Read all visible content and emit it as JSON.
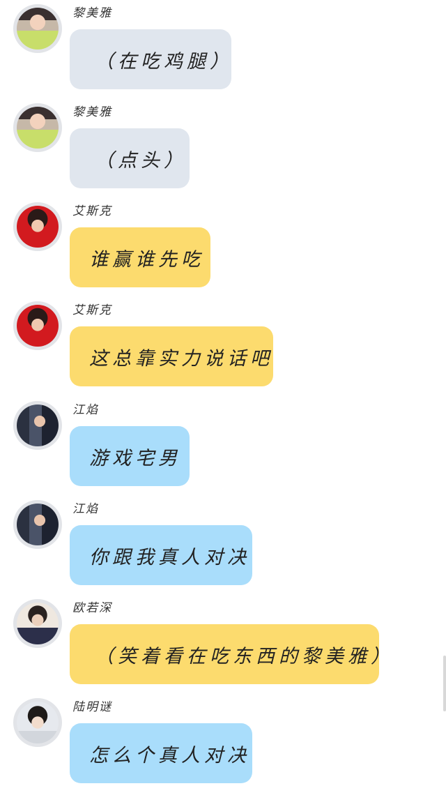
{
  "messages": [
    {
      "sender": "黎美雅",
      "text": "（在吃鸡腿）",
      "bubble_color": "#e0e6ee",
      "avatar": "woman-peace-sign-avatar"
    },
    {
      "sender": "黎美雅",
      "text": "（点头）",
      "bubble_color": "#e0e6ee",
      "avatar": "woman-peace-sign-avatar"
    },
    {
      "sender": "艾斯克",
      "text": "谁赢谁先吃",
      "bubble_color": "#fcdb6e",
      "avatar": "man-red-background-avatar"
    },
    {
      "sender": "艾斯克",
      "text": "这总靠实力说话吧",
      "bubble_color": "#fcdb6e",
      "avatar": "man-red-background-avatar"
    },
    {
      "sender": "江焰",
      "text": "游戏宅男",
      "bubble_color": "#a9ddfb",
      "avatar": "man-dark-jacket-avatar"
    },
    {
      "sender": "江焰",
      "text": "你跟我真人对决",
      "bubble_color": "#a9ddfb",
      "avatar": "man-dark-jacket-avatar"
    },
    {
      "sender": "欧若深",
      "text": "（笑着看在吃东西的黎美雅）",
      "bubble_color": "#fcdb6e",
      "avatar": "man-school-uniform-avatar"
    },
    {
      "sender": "陆明谜",
      "text": "怎么个真人对决",
      "bubble_color": "#a9ddfb",
      "avatar": "man-glasses-avatar"
    }
  ]
}
